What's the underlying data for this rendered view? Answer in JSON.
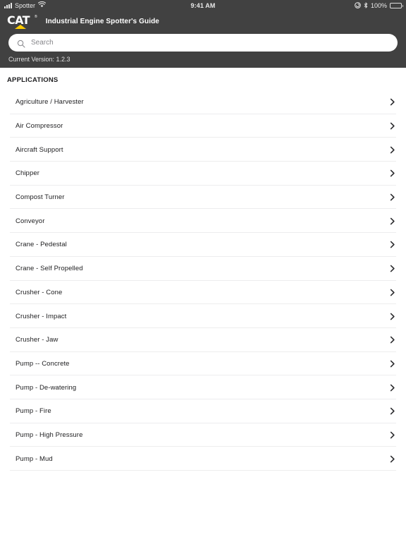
{
  "status_bar": {
    "carrier": "Spotter",
    "signal_icon": "signal-bars-icon",
    "wifi_icon": "wifi-icon",
    "time": "9:41 AM",
    "orientation_lock_icon": "rotation-lock-icon",
    "bluetooth_icon": "bluetooth-icon",
    "battery_percent": "100%",
    "battery_icon": "battery-full-icon"
  },
  "header": {
    "logo_text": "CAT",
    "logo_registered": "®",
    "logo_icon": "cat-logo-icon",
    "title": "Industrial Engine Spotter's Guide"
  },
  "search": {
    "icon": "search-icon",
    "placeholder": "Search",
    "value": ""
  },
  "version": {
    "label": "Current Version: 1.2.3"
  },
  "main": {
    "section_title": "APPLICATIONS",
    "chevron_icon": "chevron-right-icon",
    "items": [
      {
        "label": "Agriculture / Harvester"
      },
      {
        "label": "Air Compressor"
      },
      {
        "label": "Aircraft Support"
      },
      {
        "label": "Chipper"
      },
      {
        "label": "Compost Turner"
      },
      {
        "label": "Conveyor"
      },
      {
        "label": "Crane - Pedestal"
      },
      {
        "label": "Crane - Self Propelled"
      },
      {
        "label": "Crusher - Cone"
      },
      {
        "label": "Crusher - Impact"
      },
      {
        "label": "Crusher - Jaw"
      },
      {
        "label": "Pump -- Concrete"
      },
      {
        "label": "Pump - De-watering"
      },
      {
        "label": "Pump - Fire"
      },
      {
        "label": "Pump - High Pressure"
      },
      {
        "label": "Pump - Mud"
      }
    ]
  },
  "colors": {
    "header_bg": "#414141",
    "accent_yellow": "#ffcc00",
    "text_primary": "#1d1d1f",
    "separator": "#ededee",
    "placeholder": "#86868a"
  }
}
